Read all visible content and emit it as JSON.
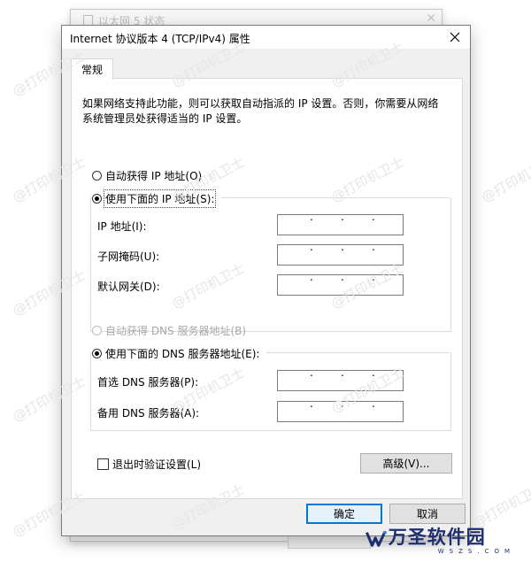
{
  "background_window": {
    "title": "以太网 5 状态"
  },
  "dialog": {
    "title": "Internet 协议版本 4 (TCP/IPv4) 属性",
    "tab_label": "常规",
    "description": "如果网络支持此功能，则可以获取自动指派的 IP 设置。否则，你需要从网络系统管理员处获得适当的 IP 设置。",
    "ip_section": {
      "auto_label": "自动获得 IP 地址(O)",
      "auto_selected": false,
      "manual_label": "使用下面的 IP 地址(S):",
      "manual_selected": true,
      "fields": [
        {
          "label": "IP 地址(I):",
          "value": ". . ."
        },
        {
          "label": "子网掩码(U):",
          "value": ". . ."
        },
        {
          "label": "默认网关(D):",
          "value": ". . ."
        }
      ]
    },
    "dns_section": {
      "auto_label": "自动获得 DNS 服务器地址(B)",
      "auto_selected": false,
      "auto_disabled": true,
      "manual_label": "使用下面的 DNS 服务器地址(E):",
      "manual_selected": true,
      "fields": [
        {
          "label": "首选 DNS 服务器(P):",
          "value": ". . ."
        },
        {
          "label": "备用 DNS 服务器(A):",
          "value": ". . ."
        }
      ]
    },
    "validate_checkbox_label": "退出时验证设置(L)",
    "validate_checked": false,
    "advanced_button": "高级(V)...",
    "ok_button": "确定",
    "cancel_button": "取消"
  },
  "watermark_text": "@打印机卫士",
  "logo": {
    "name": "万圣软件园",
    "sub": "WSZS.COM"
  },
  "colors": {
    "accent": "#0078d7",
    "dialog_bg": "#f0f0f0",
    "logo": "#1f2e6e"
  }
}
